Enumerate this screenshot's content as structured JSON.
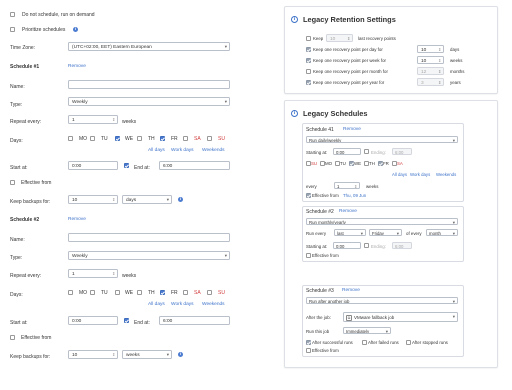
{
  "left": {
    "do_not_schedule": "Do not schedule, run on demand",
    "prioritize": "Prioritize schedules",
    "time_zone_label": "Time Zone:",
    "time_zone_value": "(UTC+02:00, EET) Eastern European",
    "schedules": [
      {
        "title": "Schedule #1",
        "remove": "Remove",
        "name_label": "Name:",
        "name_value": "",
        "type_label": "Type:",
        "type_value": "Weekly",
        "repeat_label": "Repeat every:",
        "repeat_value": "1",
        "repeat_unit": "weeks",
        "days_label": "Days:",
        "days": [
          {
            "label": "MO",
            "checked": false,
            "weekend": false
          },
          {
            "label": "TU",
            "checked": false,
            "weekend": false
          },
          {
            "label": "WE",
            "checked": true,
            "weekend": false
          },
          {
            "label": "TH",
            "checked": false,
            "weekend": false
          },
          {
            "label": "FR",
            "checked": true,
            "weekend": false
          },
          {
            "label": "SA",
            "checked": false,
            "weekend": true
          },
          {
            "label": "SU",
            "checked": false,
            "weekend": true
          }
        ],
        "all_days": "All days",
        "work_days": "Work days",
        "weekends": "Weekends",
        "start_label": "Start at:",
        "start_value": "0:00",
        "end_label": "End at:",
        "end_value": "6:00",
        "effective_label": "Effective from",
        "keep_label": "Keep backups for:",
        "keep_value": "10",
        "keep_unit": "days"
      },
      {
        "title": "Schedule #2",
        "remove": "Remove",
        "name_label": "Name:",
        "name_value": "",
        "type_label": "Type:",
        "type_value": "Weekly",
        "repeat_label": "Repeat every:",
        "repeat_value": "1",
        "repeat_unit": "weeks",
        "days_label": "Days:",
        "days": [
          {
            "label": "MO",
            "checked": false,
            "weekend": false
          },
          {
            "label": "TU",
            "checked": false,
            "weekend": false
          },
          {
            "label": "WE",
            "checked": false,
            "weekend": false
          },
          {
            "label": "TH",
            "checked": false,
            "weekend": false
          },
          {
            "label": "FR",
            "checked": true,
            "weekend": false
          },
          {
            "label": "SA",
            "checked": false,
            "weekend": true
          },
          {
            "label": "SU",
            "checked": false,
            "weekend": true
          }
        ],
        "all_days": "All days",
        "work_days": "Work days",
        "weekends": "Weekends",
        "start_label": "Start at:",
        "start_value": "0:00",
        "end_label": "End at:",
        "end_value": "6:00",
        "effective_label": "Effective from",
        "keep_label": "Keep backups for:",
        "keep_value": "10",
        "keep_unit": "weeks"
      }
    ]
  },
  "retention": {
    "title": "Legacy Retention Settings",
    "rows": [
      {
        "pre": "Keep",
        "value": "10",
        "text": "last recovery points",
        "unit": "",
        "checked": false,
        "disabled": true
      },
      {
        "pre": "",
        "value": "10",
        "text": "Keep one recovery point per day for",
        "unit": "days",
        "checked": true,
        "disabled": false
      },
      {
        "pre": "",
        "value": "10",
        "text": "Keep one recovery point per week for",
        "unit": "weeks",
        "checked": true,
        "disabled": false
      },
      {
        "pre": "",
        "value": "12",
        "text": "Keep one recovery point per month for",
        "unit": "months",
        "checked": false,
        "disabled": true
      },
      {
        "pre": "",
        "value": "3",
        "text": "Keep one recovery point per year for",
        "unit": "years",
        "checked": true,
        "disabled": true
      }
    ]
  },
  "legacy": {
    "title": "Legacy Schedules",
    "s41": {
      "title": "Schedule 41",
      "remove": "Remove",
      "type_value": "Run daily/weekly",
      "starting_label": "Starting at:",
      "starting_value": "0:00",
      "ending_label": "Ending:",
      "ending_value": "6:00",
      "days": [
        {
          "label": "SU",
          "checked": false,
          "weekend": true
        },
        {
          "label": "MO",
          "checked": false,
          "weekend": false
        },
        {
          "label": "TU",
          "checked": false,
          "weekend": false
        },
        {
          "label": "WE",
          "checked": true,
          "weekend": false
        },
        {
          "label": "TH",
          "checked": false,
          "weekend": false
        },
        {
          "label": "FR",
          "checked": true,
          "weekend": false
        },
        {
          "label": "SA",
          "checked": false,
          "weekend": true
        }
      ],
      "all_days": "All days",
      "work_days": "Work days",
      "weekends": "Weekends",
      "every_label": "every",
      "every_value": "1",
      "every_unit": "weeks",
      "effective_label": "Effective from",
      "effective_date": "Thu, 09 Jun"
    },
    "s42": {
      "title": "Schedule #2",
      "remove": "Remove",
      "type_value": "Run monthly/yearly",
      "run_label": "Run every",
      "run_ordinal": "last",
      "run_day": "Friday",
      "of_every": "of every",
      "run_period": "month",
      "starting_label": "Starting at:",
      "starting_value": "0:00",
      "ending_label": "Ending:",
      "ending_value": "6:00",
      "effective_label": "Effective from"
    },
    "s43": {
      "title": "Schedule #3",
      "remove": "Remove",
      "type_value": "Run after another job",
      "after_job_label": "After the job:",
      "after_job_value": "VMware fallback job",
      "run_this_label": "Run this job",
      "run_this_value": "Immediately",
      "after_successful": "After successful runs",
      "after_failed": "After failed runs",
      "after_stopped": "After stopped runs",
      "effective_label": "Effective from"
    }
  }
}
